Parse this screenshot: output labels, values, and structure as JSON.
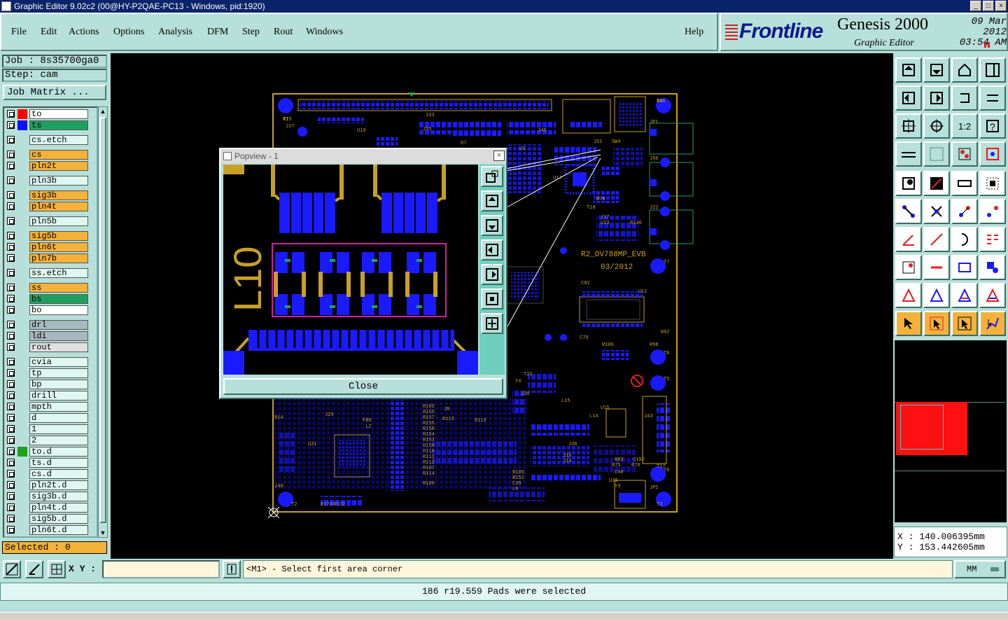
{
  "window": {
    "title": "Graphic Editor 9.02c2 (00@HY-P2QAE-PC13 - Windows, pid:1920)",
    "minimize": "_",
    "maximize": "□",
    "close": "×"
  },
  "menu": {
    "file": "File",
    "edit": "Edit",
    "actions": "Actions",
    "options": "Options",
    "analysis": "Analysis",
    "dfm": "DFM",
    "step": "Step",
    "rout": "Rout",
    "windows": "Windows",
    "help": "Help"
  },
  "brand": {
    "logo": "Frontline",
    "product": "Genesis 2000",
    "subtitle": "Graphic Editor",
    "date": "09 Mar 2012",
    "time": "03:54 AM"
  },
  "job": {
    "job": "Job : 8s35700ga0",
    "step": "Step: cam",
    "matrix_button": "Job Matrix ..."
  },
  "layers": [
    {
      "name": "to",
      "color": "#ffffff",
      "swatch": "#ff0000",
      "group": 0
    },
    {
      "name": "ts",
      "color": "#20a060",
      "swatch": "#1010ff",
      "group": 0
    },
    {
      "name": "cs.etch",
      "color": "#dff6f2",
      "swatch": "",
      "group": 1
    },
    {
      "name": "cs",
      "color": "#f4b23a",
      "swatch": "",
      "group": 2
    },
    {
      "name": "pln2t",
      "color": "#f4b23a",
      "swatch": "",
      "group": 2
    },
    {
      "name": "pln3b",
      "color": "#dff6f2",
      "swatch": "",
      "group": 3
    },
    {
      "name": "sig3b",
      "color": "#f4b23a",
      "swatch": "",
      "group": 4
    },
    {
      "name": "pln4t",
      "color": "#f4b23a",
      "swatch": "",
      "group": 4
    },
    {
      "name": "pln5b",
      "color": "#dff6f2",
      "swatch": "",
      "group": 5
    },
    {
      "name": "sig5b",
      "color": "#f4b23a",
      "swatch": "",
      "group": 6
    },
    {
      "name": "pln6t",
      "color": "#f4b23a",
      "swatch": "",
      "group": 6
    },
    {
      "name": "pln7b",
      "color": "#f4b23a",
      "swatch": "",
      "group": 6
    },
    {
      "name": "ss.etch",
      "color": "#dff6f2",
      "swatch": "",
      "group": 7
    },
    {
      "name": "ss",
      "color": "#f4b23a",
      "swatch": "",
      "group": 8
    },
    {
      "name": "bs",
      "color": "#20a060",
      "swatch": "",
      "group": 8
    },
    {
      "name": "bo",
      "color": "#ffffff",
      "swatch": "",
      "group": 8
    },
    {
      "name": "drl",
      "color": "#a8b8c0",
      "swatch": "",
      "group": 9
    },
    {
      "name": "ldi",
      "color": "#a8b8c0",
      "swatch": "",
      "group": 9
    },
    {
      "name": "rout",
      "color": "#e0e0e0",
      "swatch": "",
      "group": 9
    },
    {
      "name": "cvia",
      "color": "#dff6f2",
      "swatch": "",
      "group": 10
    },
    {
      "name": "tp",
      "color": "#dff6f2",
      "swatch": "",
      "group": 10
    },
    {
      "name": "bp",
      "color": "#dff6f2",
      "swatch": "",
      "group": 10
    },
    {
      "name": "drill",
      "color": "#dff6f2",
      "swatch": "",
      "group": 10
    },
    {
      "name": "mpth",
      "color": "#dff6f2",
      "swatch": "",
      "group": 10
    },
    {
      "name": "d",
      "color": "#dff6f2",
      "swatch": "",
      "group": 10
    },
    {
      "name": "1",
      "color": "#dff6f2",
      "swatch": "",
      "group": 10
    },
    {
      "name": "2",
      "color": "#dff6f2",
      "swatch": "",
      "group": 10
    },
    {
      "name": "to.d",
      "color": "#dff6f2",
      "swatch": "#20a020",
      "group": 10
    },
    {
      "name": "ts.d",
      "color": "#dff6f2",
      "swatch": "",
      "group": 10
    },
    {
      "name": "cs.d",
      "color": "#dff6f2",
      "swatch": "",
      "group": 10
    },
    {
      "name": "pln2t.d",
      "color": "#dff6f2",
      "swatch": "",
      "group": 10
    },
    {
      "name": "sig3b.d",
      "color": "#dff6f2",
      "swatch": "",
      "group": 10
    },
    {
      "name": "pln4t.d",
      "color": "#dff6f2",
      "swatch": "",
      "group": 10
    },
    {
      "name": "sig5b.d",
      "color": "#dff6f2",
      "swatch": "",
      "group": 10
    },
    {
      "name": "pln6t.d",
      "color": "#dff6f2",
      "swatch": "",
      "group": 10
    }
  ],
  "selected": "Selected : 0",
  "board": {
    "name": "R2_OV788MP_EVB",
    "date": "03/2012",
    "labels": [
      "T1",
      "T4",
      "T2",
      "T3",
      "T7",
      "T8",
      "T5",
      "T6",
      "J27",
      "J33",
      "J55",
      "J45",
      "J56",
      "J22",
      "U17",
      "U11",
      "T18",
      "C81",
      "C79",
      "U2",
      "D7",
      "L14",
      "L15",
      "J36",
      "J16",
      "J14",
      "U15",
      "J43",
      "T17",
      "JP1",
      "JP2",
      "J49",
      "U21",
      "R14",
      "J8",
      "L2",
      "U20",
      "Y3",
      "Y4",
      "T22",
      "J30",
      "J25",
      "J17",
      "U23",
      "R140",
      "R106",
      "R98",
      "R82",
      "R83",
      "C192",
      "R76",
      "R75",
      "C40",
      "C39",
      "L6",
      "R110",
      "R111",
      "R112",
      "R107",
      "R114",
      "R173",
      "R172",
      "R166",
      "R165",
      "R157",
      "R155",
      "R158",
      "R154",
      "R153",
      "R150",
      "R151",
      "R109",
      "R105",
      "R115",
      "R113",
      "FB9",
      "U19",
      "SW4",
      "J51",
      "R70",
      "R75",
      "R16"
    ]
  },
  "popview": {
    "title": "Popview - 1",
    "close_label": "Close",
    "label": "L10"
  },
  "coords": {
    "x": "X : 140.006395mm",
    "y": "Y : 153.442605mm"
  },
  "xy_label": "X Y :",
  "xy_value": "",
  "prompt": "<M1> - Select first area corner",
  "unit": "MM",
  "status": "186 r19.559 Pads were selected",
  "colors": {
    "bg": "#b8e0da",
    "accent": "#f4b23a",
    "pcb_copper": "#1a1aff",
    "pcb_silk": "#c8a028"
  }
}
